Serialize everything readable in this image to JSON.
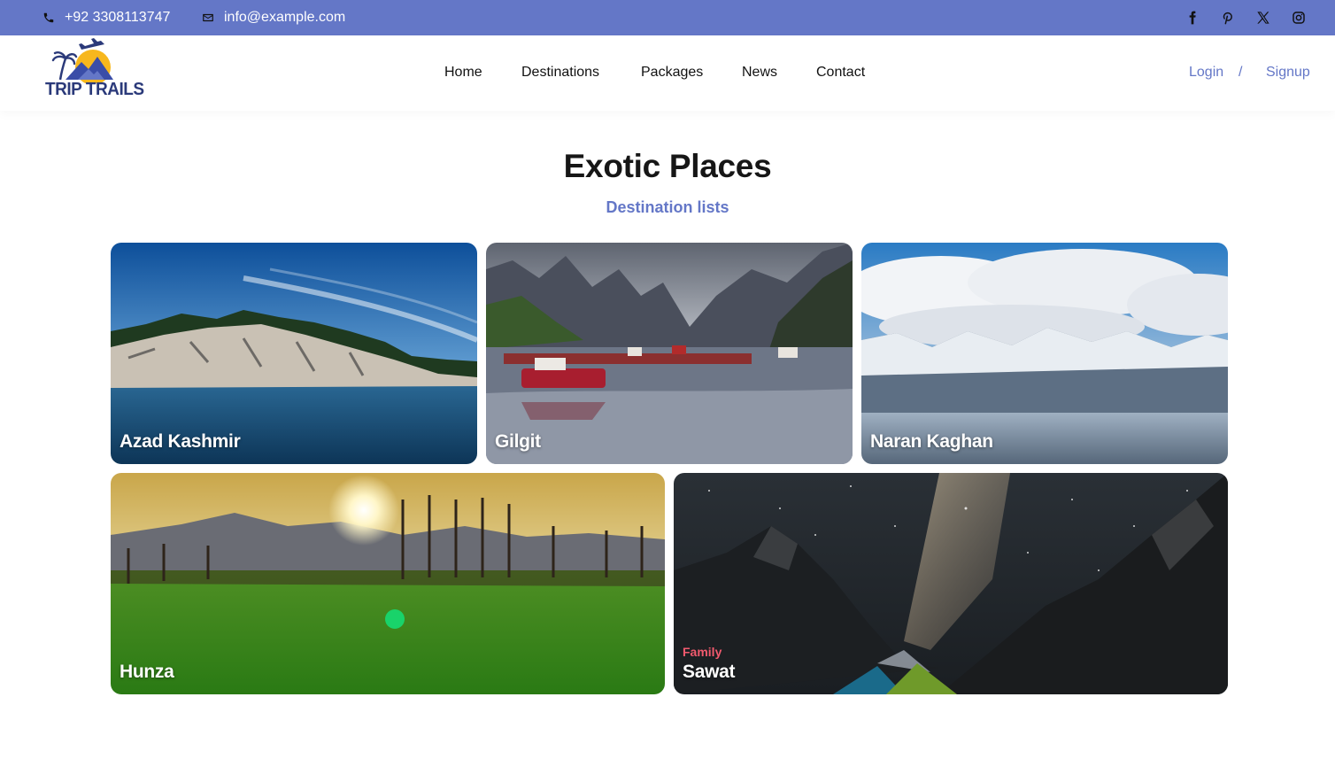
{
  "topbar": {
    "phone": "+92 3308113747",
    "email": "info@example.com",
    "social": [
      "facebook-icon",
      "pinterest-icon",
      "x-icon",
      "instagram-icon"
    ]
  },
  "brand": {
    "name": "TRIP TRAILS"
  },
  "nav": {
    "items": [
      "Home",
      "Destinations",
      "Packages",
      "News",
      "Contact"
    ],
    "login": "Login",
    "separator": "/",
    "signup": "Signup"
  },
  "section": {
    "title": "Exotic Places",
    "subtitle": "Destination lists"
  },
  "destinations": [
    {
      "name": "Azad Kashmir"
    },
    {
      "name": "Gilgit"
    },
    {
      "name": "Naran Kaghan"
    },
    {
      "name": "Hunza"
    },
    {
      "name": "Sawat",
      "tag": "Family"
    }
  ],
  "colors": {
    "accent": "#6477c7",
    "tag": "#f25a6e"
  }
}
